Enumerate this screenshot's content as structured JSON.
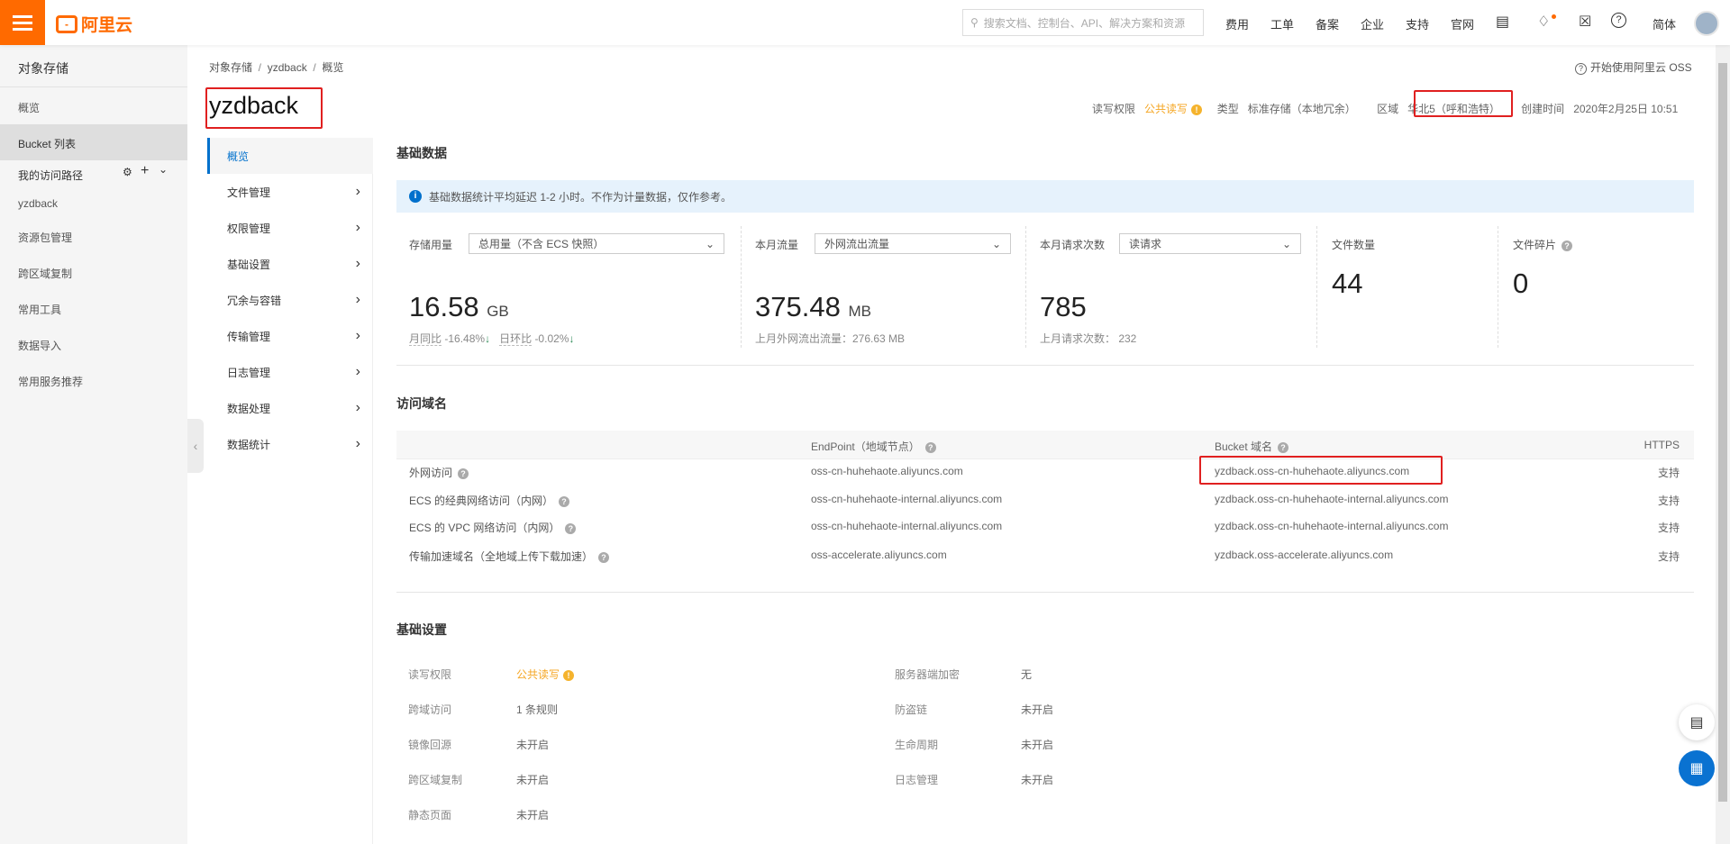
{
  "topbar": {
    "logo": "阿里云",
    "search_placeholder": "搜索文档、控制台、API、解决方案和资源",
    "nav": [
      "费用",
      "工单",
      "备案",
      "企业",
      "支持",
      "官网"
    ],
    "lang": "简体"
  },
  "sidebar": {
    "title": "对象存储",
    "items": [
      "概览",
      "Bucket 列表"
    ],
    "path_label": "我的访问路径",
    "path_item": "yzdback",
    "more": [
      "资源包管理",
      "跨区域复制",
      "常用工具",
      "数据导入",
      "常用服务推荐"
    ]
  },
  "breadcrumb": [
    "对象存储",
    "yzdback",
    "概览"
  ],
  "help_link": "开始使用阿里云 OSS",
  "title": "yzdback",
  "meta": {
    "acl_label": "读写权限",
    "acl_value": "公共读写",
    "type_label": "类型",
    "type_value": "标准存储（本地冗余）",
    "region_label": "区域",
    "region_value": "华北5（呼和浩特）",
    "created_label": "创建时间",
    "created_value": "2020年2月25日 10:51"
  },
  "subnav": [
    "概览",
    "文件管理",
    "权限管理",
    "基础设置",
    "冗余与容错",
    "传输管理",
    "日志管理",
    "数据处理",
    "数据统计"
  ],
  "basic_data": {
    "heading": "基础数据",
    "notice": "基础数据统计平均延迟 1-2 小时。不作为计量数据，仅作参考。",
    "storage": {
      "label": "存储用量",
      "select": "总用量（不含 ECS 快照）",
      "value": "16.58",
      "unit": "GB",
      "mom_label": "月同比",
      "mom": "-16.48%",
      "dod_label": "日环比",
      "dod": "-0.02%"
    },
    "traffic": {
      "label": "本月流量",
      "select": "外网流出流量",
      "value": "375.48",
      "unit": "MB",
      "last": "上月外网流出流量：276.63 MB"
    },
    "requests": {
      "label": "本月请求次数",
      "select": "读请求",
      "value": "785",
      "last": "上月请求次数：  232"
    },
    "files": {
      "label": "文件数量",
      "value": "44"
    },
    "fragments": {
      "label": "文件碎片",
      "value": "0"
    }
  },
  "domains": {
    "heading": "访问域名",
    "headers": [
      "EndPoint（地域节点）",
      "Bucket 域名",
      "HTTPS"
    ],
    "rows": [
      {
        "name": "外网访问",
        "endpoint": "oss-cn-huhehaote.aliyuncs.com",
        "bucket": "yzdback.oss-cn-huhehaote.aliyuncs.com",
        "https": "支持"
      },
      {
        "name": "ECS 的经典网络访问（内网）",
        "endpoint": "oss-cn-huhehaote-internal.aliyuncs.com",
        "bucket": "yzdback.oss-cn-huhehaote-internal.aliyuncs.com",
        "https": "支持"
      },
      {
        "name": "ECS 的 VPC 网络访问（内网）",
        "endpoint": "oss-cn-huhehaote-internal.aliyuncs.com",
        "bucket": "yzdback.oss-cn-huhehaote-internal.aliyuncs.com",
        "https": "支持"
      },
      {
        "name": "传输加速域名（全地域上传下载加速）",
        "endpoint": "oss-accelerate.aliyuncs.com",
        "bucket": "yzdback.oss-accelerate.aliyuncs.com",
        "https": "支持"
      }
    ]
  },
  "settings": {
    "heading": "基础设置",
    "left": [
      {
        "label": "读写权限",
        "value": "公共读写"
      },
      {
        "label": "跨域访问",
        "value": "1 条规则"
      },
      {
        "label": "镜像回源",
        "value": "未开启"
      },
      {
        "label": "跨区域复制",
        "value": "未开启"
      },
      {
        "label": "静态页面",
        "value": "未开启"
      }
    ],
    "right": [
      {
        "label": "服务器端加密",
        "value": "无"
      },
      {
        "label": "防盗链",
        "value": "未开启"
      },
      {
        "label": "生命周期",
        "value": "未开启"
      },
      {
        "label": "日志管理",
        "value": "未开启"
      }
    ]
  },
  "colors": {
    "brand": "#ff6a00",
    "accent": "#0070cc",
    "warning": "#f5b32d",
    "highlight": "#e02020"
  }
}
